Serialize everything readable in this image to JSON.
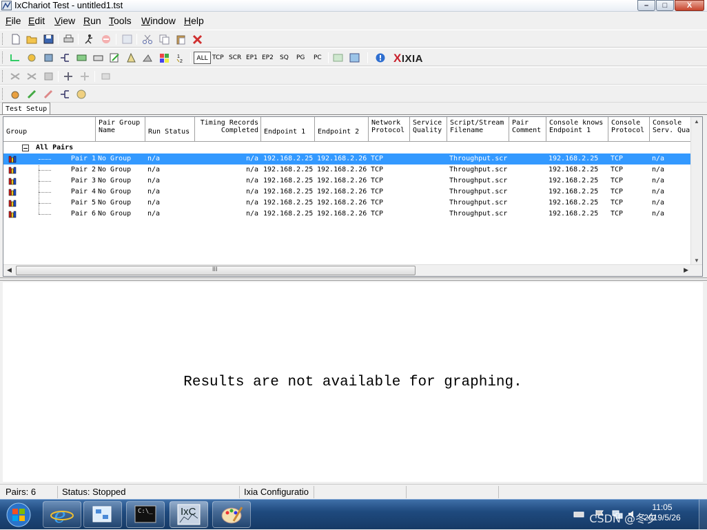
{
  "window": {
    "title": "IxChariot Test - untitled1.tst",
    "minimize": "–",
    "maximize": "□",
    "close": "X"
  },
  "menu": {
    "file": {
      "hotkey": "F",
      "rest": "ile"
    },
    "edit": {
      "hotkey": "E",
      "rest": "dit"
    },
    "view": {
      "hotkey": "V",
      "rest": "iew"
    },
    "run": {
      "hotkey": "R",
      "rest": "un"
    },
    "tools": {
      "hotkey": "T",
      "rest": "ools"
    },
    "window": {
      "hotkey": "W",
      "rest": "indow"
    },
    "help": {
      "hotkey": "H",
      "rest": "elp"
    }
  },
  "filters": {
    "all": "ALL",
    "tcp": "TCP",
    "scr": "SCR",
    "ep1": "EP1",
    "ep2": "EP2",
    "sq": "SQ",
    "pg": "PG",
    "pc": "PC"
  },
  "brand": {
    "x": "X",
    "rest": "IXIA"
  },
  "tab": {
    "label": "Test Setup"
  },
  "columns": [
    {
      "line1": "",
      "line2": "Group"
    },
    {
      "line1": "Pair Group",
      "line2": "Name"
    },
    {
      "line1": "",
      "line2": "Run Status"
    },
    {
      "line1": "Timing Records",
      "line2": "Completed"
    },
    {
      "line1": "",
      "line2": "Endpoint 1"
    },
    {
      "line1": "",
      "line2": "Endpoint 2"
    },
    {
      "line1": "Network",
      "line2": "Protocol"
    },
    {
      "line1": "Service",
      "line2": "Quality"
    },
    {
      "line1": "Script/Stream",
      "line2": "Filename"
    },
    {
      "line1": "Pair",
      "line2": "Comment"
    },
    {
      "line1": "Console knows",
      "line2": "Endpoint 1"
    },
    {
      "line1": "Console",
      "line2": "Protocol"
    },
    {
      "line1": "Console",
      "line2": "Serv. Qua"
    }
  ],
  "group": {
    "label": "All Pairs"
  },
  "pairs": [
    {
      "name": "Pair 1",
      "group": "No Group",
      "status": "n/a",
      "timing": "n/a",
      "ep1": "192.168.2.25",
      "ep2": "192.168.2.26",
      "protocol": "TCP",
      "script": "Throughput.scr",
      "console_ep1": "192.168.2.25",
      "console_protocol": "TCP",
      "console_sq": "n/a"
    },
    {
      "name": "Pair 2",
      "group": "No Group",
      "status": "n/a",
      "timing": "n/a",
      "ep1": "192.168.2.25",
      "ep2": "192.168.2.26",
      "protocol": "TCP",
      "script": "Throughput.scr",
      "console_ep1": "192.168.2.25",
      "console_protocol": "TCP",
      "console_sq": "n/a"
    },
    {
      "name": "Pair 3",
      "group": "No Group",
      "status": "n/a",
      "timing": "n/a",
      "ep1": "192.168.2.25",
      "ep2": "192.168.2.26",
      "protocol": "TCP",
      "script": "Throughput.scr",
      "console_ep1": "192.168.2.25",
      "console_protocol": "TCP",
      "console_sq": "n/a"
    },
    {
      "name": "Pair 4",
      "group": "No Group",
      "status": "n/a",
      "timing": "n/a",
      "ep1": "192.168.2.25",
      "ep2": "192.168.2.26",
      "protocol": "TCP",
      "script": "Throughput.scr",
      "console_ep1": "192.168.2.25",
      "console_protocol": "TCP",
      "console_sq": "n/a"
    },
    {
      "name": "Pair 5",
      "group": "No Group",
      "status": "n/a",
      "timing": "n/a",
      "ep1": "192.168.2.25",
      "ep2": "192.168.2.26",
      "protocol": "TCP",
      "script": "Throughput.scr",
      "console_ep1": "192.168.2.25",
      "console_protocol": "TCP",
      "console_sq": "n/a"
    },
    {
      "name": "Pair 6",
      "group": "No Group",
      "status": "n/a",
      "timing": "n/a",
      "ep1": "192.168.2.25",
      "ep2": "192.168.2.26",
      "protocol": "TCP",
      "script": "Throughput.scr",
      "console_ep1": "192.168.2.25",
      "console_protocol": "TCP",
      "console_sq": "n/a"
    }
  ],
  "scroll": {
    "grip": "III",
    "left": "◀",
    "right": "▶",
    "up": "▲",
    "down": "▼"
  },
  "results": {
    "message": "Results are not available for graphing."
  },
  "status": {
    "pairs": "Pairs: 6",
    "state": "Status: Stopped",
    "config": "Ixia Configuratio"
  },
  "taskbar": {
    "cmd_label": "C:\\_",
    "ixc_label": "IxC",
    "time": "11:05",
    "date": "2019/5/26",
    "watermark": "CSDN @冬夕"
  },
  "colors": {
    "selection": "#3399ff",
    "brand_red": "#c8202c",
    "taskbar": "#1f4a7e"
  }
}
